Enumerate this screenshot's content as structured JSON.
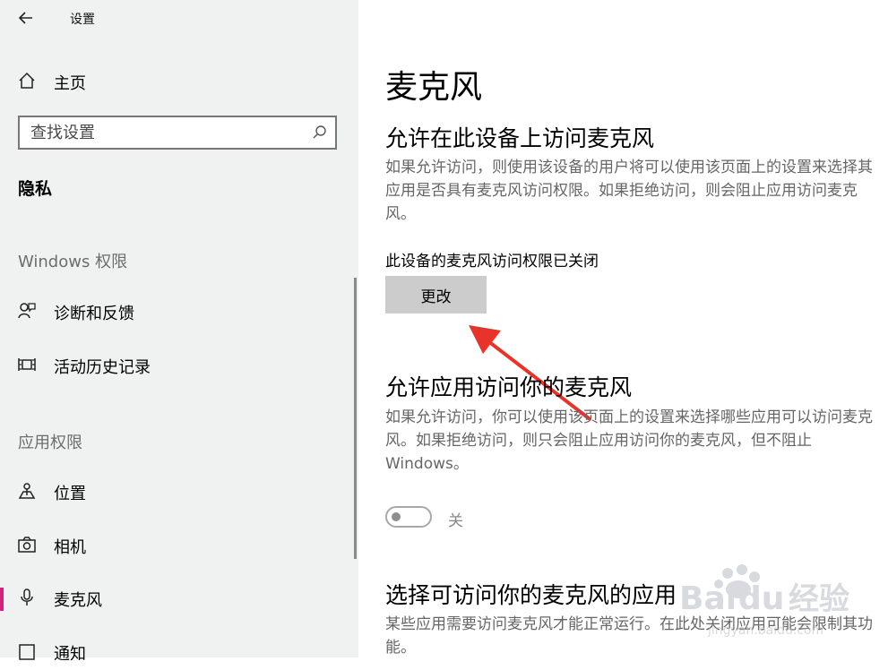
{
  "header": {
    "title": "设置"
  },
  "sidebar": {
    "home_label": "主页",
    "search": {
      "placeholder": "查找设置"
    },
    "section_title": "隐私",
    "groups": [
      {
        "title": "Windows 权限",
        "items": [
          {
            "label": "诊断和反馈",
            "icon": "diagnostics-icon"
          },
          {
            "label": "活动历史记录",
            "icon": "activity-history-icon"
          }
        ]
      },
      {
        "title": "应用权限",
        "items": [
          {
            "label": "位置",
            "icon": "location-icon"
          },
          {
            "label": "相机",
            "icon": "camera-icon"
          },
          {
            "label": "麦克风",
            "icon": "microphone-icon",
            "selected": true
          },
          {
            "label": "通知",
            "icon": "notification-icon"
          }
        ]
      }
    ]
  },
  "main": {
    "title": "麦克风",
    "device_access": {
      "heading": "允许在此设备上访问麦克风",
      "description": "如果允许访问，则使用该设备的用户将可以使用该页面上的设置来选择其应用是否具有麦克风访问权限。如果拒绝访问，则会阻止应用访问麦克风。",
      "status": "此设备的麦克风访问权限已关闭",
      "change_button": "更改"
    },
    "app_access": {
      "heading": "允许应用访问你的麦克风",
      "description": "如果允许访问，你可以使用该页面上的设置来选择哪些应用可以访问麦克风。如果拒绝访问，则只会阻止应用访问你的麦克风，但不阻止 Windows。",
      "toggle_label": "关",
      "toggle_on": false
    },
    "choose_apps": {
      "heading": "选择可访问你的麦克风的应用",
      "description": "某些应用需要访问麦克风才能正常运行。在此处关闭应用可能会限制其功能。"
    }
  },
  "colors": {
    "accent": "#d0247a",
    "sidebar_bg": "#f0f2f2",
    "button_bg": "#cccccc",
    "arrow": "#e8332a"
  }
}
